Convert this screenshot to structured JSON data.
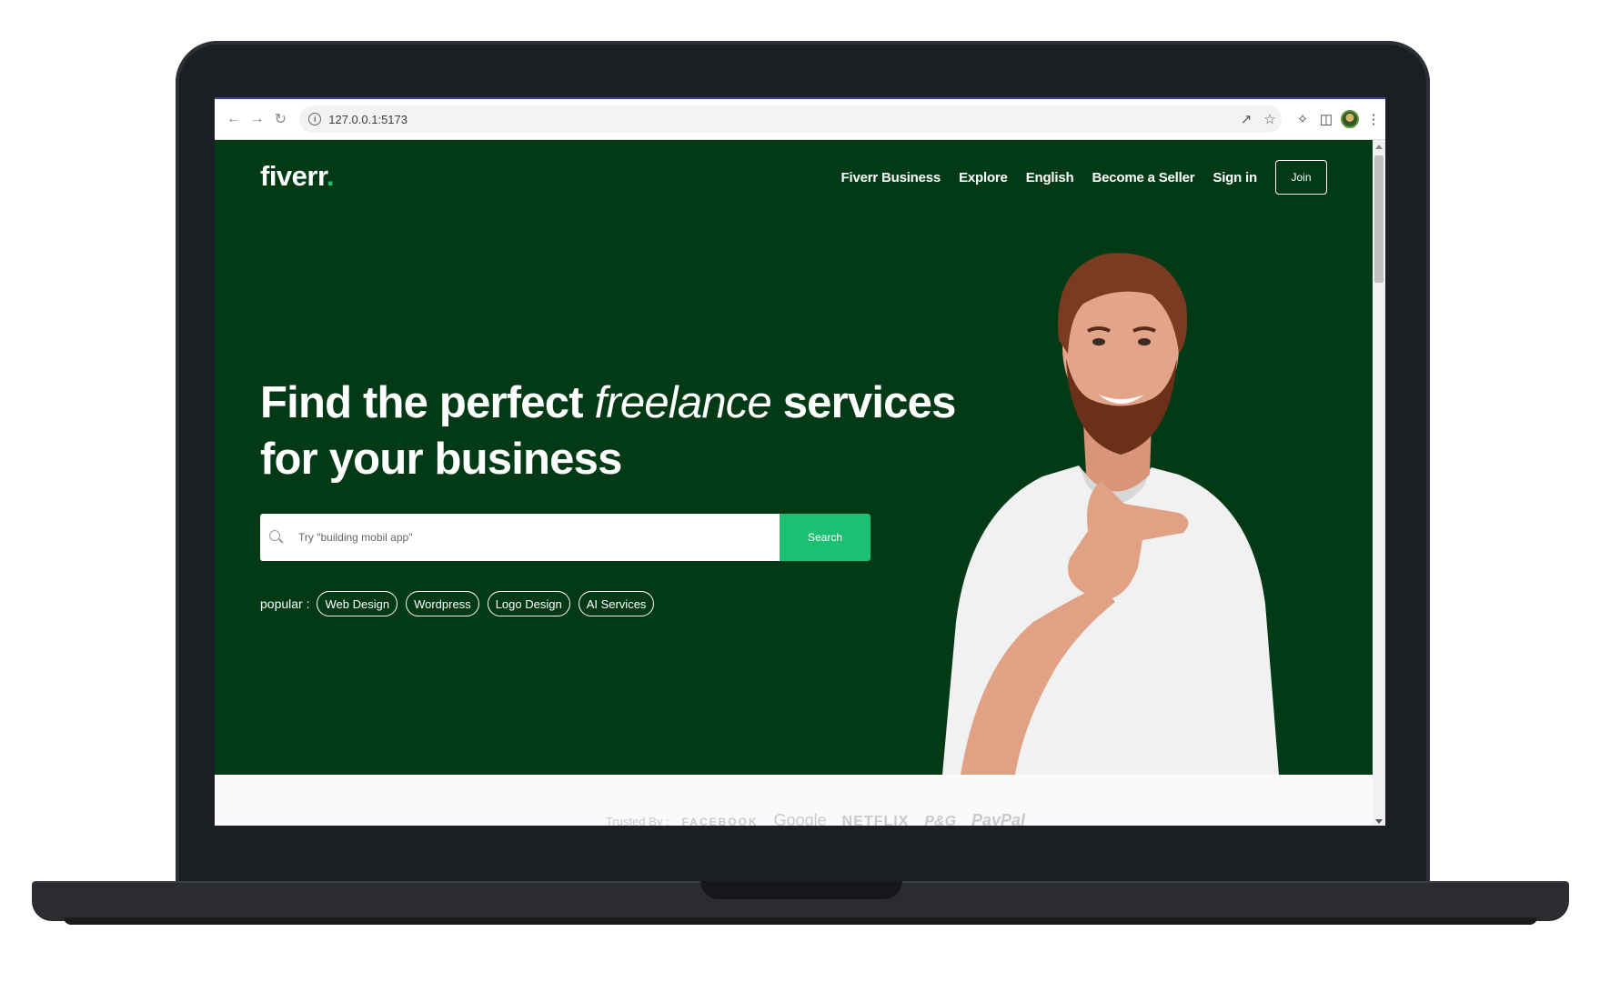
{
  "browser": {
    "url": "127.0.0.1:5173",
    "icons": {
      "back": "arrow-left-icon",
      "forward": "arrow-right-icon",
      "reload": "reload-icon",
      "site_info": "info-icon",
      "share": "share-icon",
      "bookmark": "star-icon",
      "extensions": "puzzle-icon",
      "side_panel": "side-panel-icon",
      "profile": "profile-avatar",
      "menu": "kebab-menu-icon"
    }
  },
  "header": {
    "logo_text": "fiverr",
    "logo_dot": ".",
    "nav": {
      "fiverr_business": "Fiverr Business",
      "explore": "Explore",
      "english": "English",
      "become_seller": "Become a Seller",
      "sign_in": "Sign in",
      "join": "Join"
    }
  },
  "hero": {
    "headline_part1": "Find the perfect ",
    "headline_emphasis": "freelance",
    "headline_part2": " services",
    "headline_line2": "for your business",
    "search": {
      "placeholder": "Try \"building mobil app\"",
      "button": "Search"
    },
    "popular": {
      "label": "popular :",
      "items": [
        "Web Design",
        "Wordpress",
        "Logo Design",
        "AI Services"
      ]
    }
  },
  "trusted": {
    "label": "Trusted By :",
    "brands": [
      "FACEBOOK",
      "Google",
      "NETFLIX",
      "P&G",
      "PayPal"
    ]
  },
  "colors": {
    "hero_bg": "#023a15",
    "accent": "#1dbf73",
    "text_light": "#ffffff"
  }
}
